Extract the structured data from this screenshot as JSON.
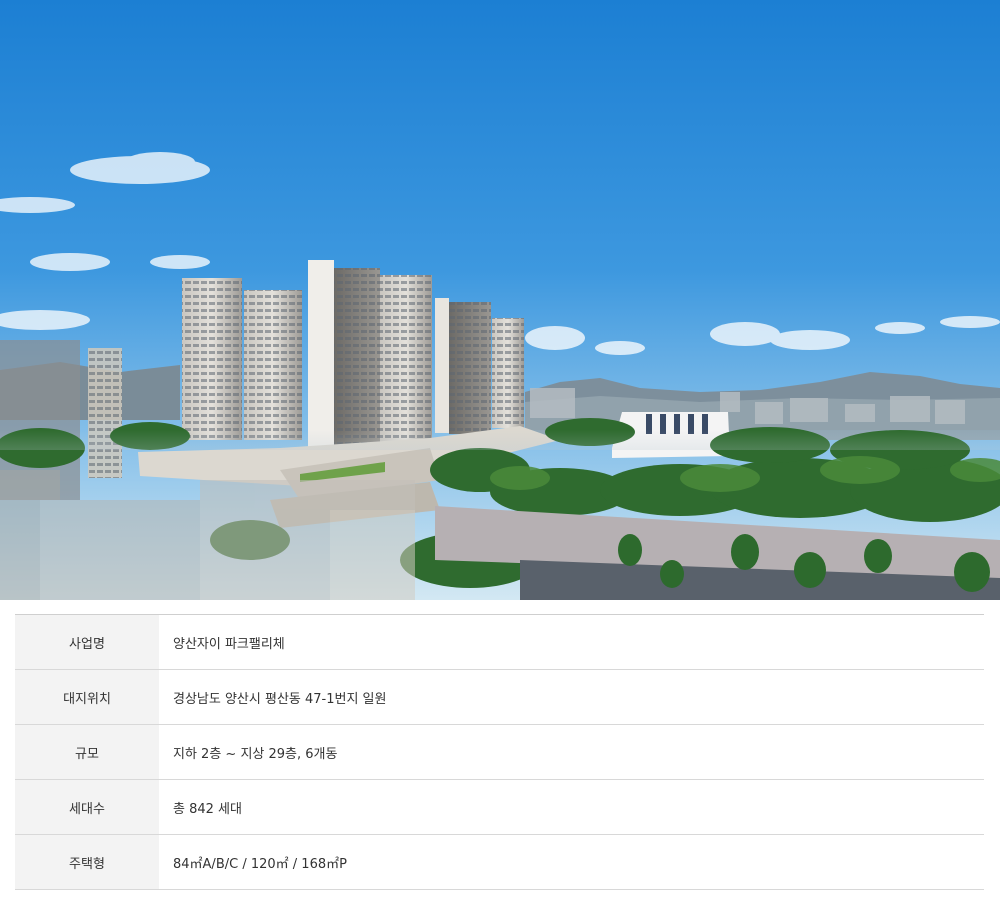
{
  "hero": {
    "sky_top": "#1f86d6",
    "sky_bottom": "#bfe0f4"
  },
  "info_table": {
    "rows": [
      {
        "label": "사업명",
        "value": "양산자이 파크팰리체"
      },
      {
        "label": "대지위치",
        "value": "경상남도 양산시 평산동 47-1번지 일원"
      },
      {
        "label": "규모",
        "value": "지하 2층 ~ 지상 29층, 6개동"
      },
      {
        "label": "세대수",
        "value": "총 842 세대"
      },
      {
        "label": "주택형",
        "value": "84㎡A/B/C / 120㎡ / 168㎡P"
      }
    ]
  }
}
